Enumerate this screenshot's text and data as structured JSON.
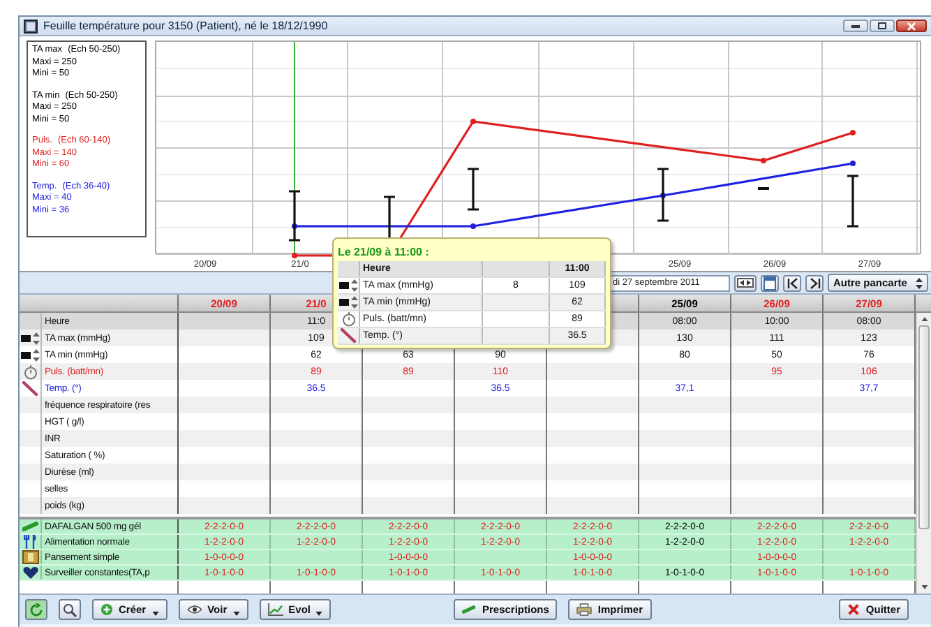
{
  "window": {
    "title": "Feuille température pour 3150 (Patient), né le 18/12/1990"
  },
  "legend": [
    {
      "name": "TA max",
      "scale": "(Ech 50-250)",
      "max": "Maxi = 250",
      "min": "Mini = 50",
      "color": "#000000"
    },
    {
      "name": "TA min",
      "scale": "(Ech 50-250)",
      "max": "Maxi = 250",
      "min": "Mini = 50",
      "color": "#000000"
    },
    {
      "name": "Puls.",
      "scale": "(Ech 60-140)",
      "max": "Maxi = 140",
      "min": "Mini = 60",
      "color": "#e02020"
    },
    {
      "name": "Temp.",
      "scale": "(Ech 36-40)",
      "max": "Maxi = 40",
      "min": "Mini = 36",
      "color": "#2020e0"
    }
  ],
  "toolbar": {
    "date_field": {
      "value": "di 27 septembre 2011"
    },
    "select": {
      "value": "Autre pancarte"
    }
  },
  "tooltip": {
    "title": "Le 21/09 à 11:00 :",
    "rows": [
      {
        "kind": "time",
        "label": "Heure",
        "value": "11:00"
      },
      {
        "kind": "pressure",
        "label": "TA max (mmHg)",
        "note": "8",
        "value": "109"
      },
      {
        "kind": "pressure",
        "label": "TA min (mmHg)",
        "value": "62"
      },
      {
        "kind": "pulse",
        "label": "Puls. (batt/mn)",
        "value": "89"
      },
      {
        "kind": "temperature",
        "label": "Temp. (°)",
        "value": "36.5"
      }
    ]
  },
  "table": {
    "columns": [
      {
        "axis_label": "20/09",
        "date": "20/09",
        "color": "#e02020",
        "doses": {
          "drug": "2-2-2-0-0",
          "meal": "1-2-2-0-0",
          "dressing": "1-0-0-0-0",
          "monitoring": "1-0-1-0-0"
        }
      },
      {
        "axis_label": "21/0",
        "date": "21/0",
        "color": "#e02020",
        "doses": {
          "drug": "2-2-2-0-0",
          "meal": "1-2-2-0-0",
          "monitoring": "1-0-1-0-0"
        }
      },
      {
        "color": "#e02020",
        "doses": {
          "drug": "2-2-2-0-0",
          "meal": "1-2-2-0-0",
          "dressing": "1-0-0-0-0",
          "monitoring": "1-0-1-0-0"
        }
      },
      {
        "color": "#e02020",
        "doses": {
          "drug": "2-2-2-0-0",
          "meal": "1-2-2-0-0",
          "monitoring": "1-0-1-0-0"
        }
      },
      {
        "color": "#e02020",
        "doses": {
          "drug": "2-2-2-0-0",
          "meal": "1-2-2-0-0",
          "dressing": "1-0-0-0-0",
          "monitoring": "1-0-1-0-0"
        }
      },
      {
        "axis_label": "25/09",
        "date": "25/09",
        "color": "#000000",
        "doses": {
          "drug": "2-2-2-0-0",
          "meal": "1-2-2-0-0",
          "monitoring": "1-0-1-0-0"
        }
      },
      {
        "axis_label": "26/09",
        "date": "26/09",
        "color": "#e02020",
        "doses": {
          "drug": "2-2-2-0-0",
          "meal": "1-2-2-0-0",
          "dressing": "1-0-0-0-0",
          "monitoring": "1-0-1-0-0"
        }
      },
      {
        "axis_label": "27/09",
        "date": "27/09",
        "color": "#e02020",
        "doses": {
          "drug": "2-2-2-0-0",
          "meal": "1-2-2-0-0",
          "monitoring": "1-0-1-0-0"
        }
      }
    ],
    "rows": [
      {
        "kind": "time",
        "label": "Heure",
        "cells": [
          {},
          {
            "text": "11:0"
          },
          {},
          {},
          {},
          {
            "text": "08:00"
          },
          {
            "text": "10:00"
          },
          {
            "text": "08:00"
          }
        ]
      },
      {
        "kind": "pressure",
        "label": "TA max (mmHg)",
        "cells": [
          {},
          {
            "text": "109"
          },
          {},
          {},
          {},
          {
            "text": "130"
          },
          {
            "text": "111"
          },
          {
            "text": "123"
          }
        ]
      },
      {
        "kind": "pressure",
        "label": "TA min (mmHg)",
        "cells": [
          {},
          {
            "text": "62"
          },
          {
            "text": "63"
          },
          {
            "text": "90"
          },
          {},
          {
            "text": "80"
          },
          {
            "text": "50"
          },
          {
            "text": "76"
          }
        ]
      },
      {
        "kind": "pulse",
        "label": "Puls. (batt/mn)",
        "cells": [
          {},
          {
            "text": "89"
          },
          {
            "text": "89"
          },
          {
            "text": "110"
          },
          {},
          {},
          {
            "text": "95"
          },
          {
            "text": "106"
          }
        ]
      },
      {
        "kind": "temperature",
        "label": "Temp. (°)",
        "cells": [
          {},
          {
            "text": "36.5"
          },
          {},
          {
            "text": "36.5"
          },
          {},
          {
            "text": "37,1"
          },
          {},
          {
            "text": "37,7"
          }
        ]
      },
      {
        "kind": "plain",
        "label": "fréquence respiratoire (res"
      },
      {
        "kind": "plain",
        "label": "HGT ( g/l)"
      },
      {
        "kind": "plain",
        "label": "INR"
      },
      {
        "kind": "plain",
        "label": "Saturation ( %)"
      },
      {
        "kind": "plain",
        "label": "Diurèse (ml)"
      },
      {
        "kind": "plain",
        "label": "selles"
      },
      {
        "kind": "plain",
        "label": "poids (kg)"
      }
    ],
    "prescriptions": [
      {
        "kind": "drug",
        "label": "DAFALGAN 500 mg gél"
      },
      {
        "kind": "meal",
        "label": "Alimentation normale"
      },
      {
        "kind": "dressing",
        "label": "Pansement simple"
      },
      {
        "kind": "monitoring",
        "label": "Surveiller constantes(TA,p"
      }
    ]
  },
  "buttons": [
    {
      "kind": "refresh"
    },
    {
      "kind": "zoom"
    },
    {
      "kind": "create",
      "label": "Créer",
      "dropdown": true
    },
    {
      "kind": "view",
      "label": "Voir",
      "dropdown": true
    },
    {
      "kind": "chart",
      "label": "Evol",
      "dropdown": true
    },
    {
      "kind": "prescriptions",
      "label": "Prescriptions",
      "dropdown": false
    },
    {
      "kind": "print",
      "label": "Imprimer",
      "dropdown": false
    },
    {
      "kind": "quit",
      "label": "Quitter",
      "dropdown": false
    }
  ]
}
